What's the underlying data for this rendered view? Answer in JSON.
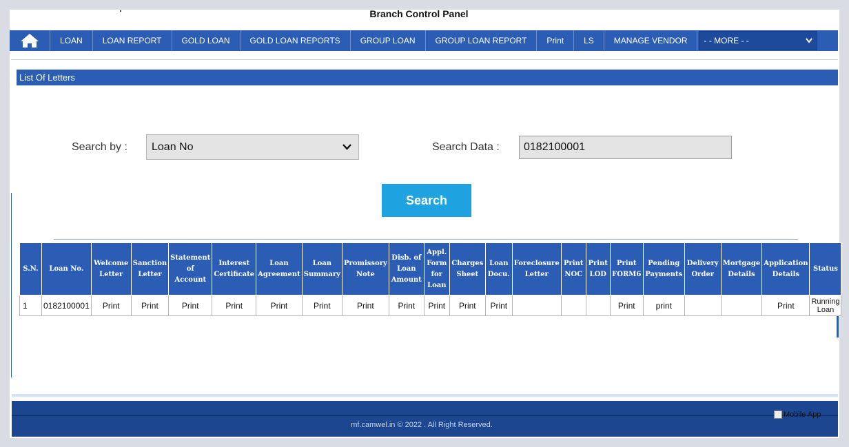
{
  "header": {
    "title": "Branch Control Panel"
  },
  "nav": {
    "home_icon": "home-icon",
    "items": [
      "LOAN",
      "LOAN REPORT",
      "GOLD LOAN",
      "GOLD LOAN REPORTS",
      "GROUP LOAN",
      "GROUP LOAN REPORT",
      "Print",
      "LS",
      "MANAGE VENDOR"
    ],
    "more_label": "- - MORE - -"
  },
  "section": {
    "title": "List Of Letters"
  },
  "search": {
    "by_label": "Search by :",
    "by_value": "Loan No",
    "data_label": "Search Data :",
    "data_value": "0182100001",
    "button_label": "Search"
  },
  "table": {
    "headers": [
      "S.N.",
      "Loan No.",
      "Welcome Letter",
      "Sanction Letter",
      "Statement of Account",
      "Interest Certificate",
      "Loan Agreement",
      "Loan Summary",
      "Promissory Note",
      "Disb. of Loan Amount",
      "Appl. Form for Loan",
      "Charges Sheet",
      "Loan Docu.",
      "Foreclosure Letter",
      "Print NOC",
      "Print LOD",
      "Print FORM6",
      "Pending Payments",
      "Delivery Order",
      "Mortgage Details",
      "Application Details",
      "Status"
    ],
    "rows": [
      [
        "1",
        "0182100001",
        "Print",
        "Print",
        "Print",
        "Print",
        "Print",
        "Print",
        "Print",
        "Print",
        "Print",
        "Print",
        "Print",
        "",
        "",
        "",
        "Print",
        "print",
        "",
        "",
        "Print",
        "Running Loan"
      ]
    ]
  },
  "footer": {
    "copyright": "mf.camwel.in © 2022 . All Right Reserved.",
    "mobile_app_alt": "Mobile App"
  },
  "colors": {
    "primary": "#2b5db4",
    "accent": "#1fa3e0",
    "footer": "#1c4690"
  }
}
